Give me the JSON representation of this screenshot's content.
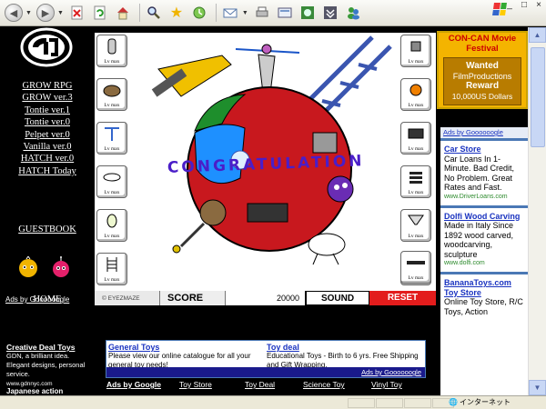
{
  "browser": {
    "toolbar_icons": [
      "back-icon",
      "forward-icon",
      "stop-icon",
      "refresh-icon",
      "home-icon",
      "search-icon",
      "favorites-icon",
      "history-icon",
      "mail-icon",
      "print-icon",
      "edit-icon",
      "discuss-icon",
      "research-icon",
      "messenger-icon"
    ],
    "window_controls": [
      "_",
      "□",
      "×"
    ]
  },
  "leftnav": {
    "links": [
      "GROW RPG",
      "GROW ver.3",
      "Tontie ver.1",
      "Tontie ver.0",
      "Pelpet ver.0",
      "Vanilla ver.0",
      "HATCH ver.0",
      "HATCH Today"
    ],
    "guestbook": "GUESTBOOK",
    "home": "HOME",
    "ads_label": "Ads by Goooooogle",
    "deal_title": "Creative Deal Toys",
    "deal_text": "GDN, a brilliant idea. Elegant designs, personal service.",
    "deal_url": "www.gdnnyc.com",
    "japanese": "Japanese action"
  },
  "game": {
    "slot_label": "Lv max",
    "left_slots": [
      "cylinder-icon",
      "gear-icon",
      "pole-icon",
      "dish-icon",
      "egg-icon",
      "ladder-icon"
    ],
    "right_slots": [
      "cube-icon",
      "ball-icon",
      "device-icon",
      "stack-icon",
      "funnel-icon",
      "mountain-icon",
      "bar-icon"
    ],
    "congrats": "CONGRATULATION",
    "brand": "EYEZMAZE",
    "score_label": "SCORE",
    "score_value": "20000",
    "sound_label": "SOUND",
    "reset_label": "RESET"
  },
  "promo": {
    "title": "CON-CAN Movie Festival",
    "wanted": "Wanted",
    "film": "FilmProductions",
    "reward": "Reward",
    "dollars": "10,000US Dollars"
  },
  "right_ads": {
    "header": "Ads by Goooooogle",
    "items": [
      {
        "title": "Car Store",
        "body": "Car Loans In 1-Minute. Bad Credit, No Problem. Great Rates and Fast.",
        "url": "www.DriverLoans.com"
      },
      {
        "title": "Dolfi Wood Carving",
        "body": "Made in Italy Since 1892 wood carved, woodcarving, sculpture",
        "url": "www.dolfi.com"
      },
      {
        "title": "BananaToys.com Toy Store",
        "body": "Online Toy Store, R/C Toys, Action",
        "url": ""
      }
    ]
  },
  "bottom_ads": {
    "left_title": "General Toys",
    "left_body": "Please view our online catalogue for all your general toy needs!",
    "right_title": "Toy deal",
    "right_body": "Educational Toys - Birth to 6 yrs. Free Shipping and Gift Wrapping.",
    "by": "Ads by Goooooogle"
  },
  "bottom_links": [
    "Ads by Google",
    "Toy Store",
    "Toy Deal",
    "Science Toy",
    "Vinyl Toy"
  ],
  "status": {
    "zone": "インターネット"
  }
}
